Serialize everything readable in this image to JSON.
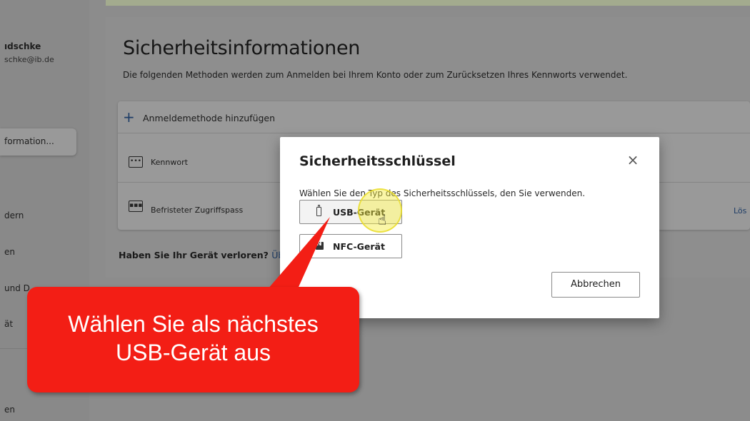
{
  "sidebar": {
    "user_name": "ıdschke",
    "user_email": "schke@ib.de",
    "active_item": "formation...",
    "items": [
      "dern",
      "en",
      "und D",
      "ät",
      "en"
    ]
  },
  "page": {
    "title": "Sicherheitsinformationen",
    "subtitle": "Die folgenden Methoden werden zum Anmelden bei Ihrem Konto oder zum Zurücksetzen Ihres Kennworts verwendet.",
    "add_method": "Anmeldemethode hinzufügen",
    "methods": [
      {
        "icon": "password-dots-icon",
        "label": "Kennwort"
      },
      {
        "icon": "temporary-pass-icon",
        "label": "Befristeter Zugriffspass"
      }
    ],
    "remove_link": "Lös",
    "lost_device": "Haben Sie Ihr Gerät verloren?",
    "lost_device_link": "Üb"
  },
  "dialog": {
    "title": "Sicherheitsschlüssel",
    "description": "Wählen Sie den Typ des Sicherheitsschlüssels, den Sie verwenden.",
    "options": [
      {
        "icon": "usb-key-icon",
        "label": "USB-Gerät"
      },
      {
        "icon": "nfc-icon",
        "label": "NFC-Gerät"
      }
    ],
    "cancel": "Abbrechen",
    "close_glyph": "×"
  },
  "callout": {
    "line1": "Wählen Sie als nächstes",
    "line2": "USB-Gerät aus",
    "color": "#f31e15"
  }
}
